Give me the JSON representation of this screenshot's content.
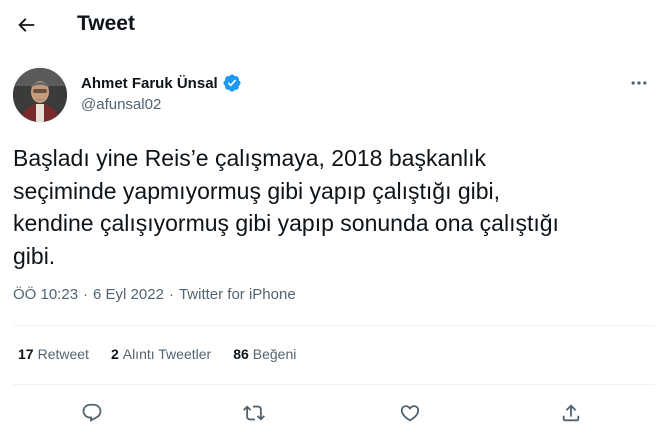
{
  "header": {
    "title": "Tweet",
    "back_icon": "arrow-left-icon"
  },
  "author": {
    "name": "Ahmet Faruk Ünsal",
    "handle": "@afunsal02",
    "verified": true,
    "verified_color": "#1d9bf0"
  },
  "tweet": {
    "text": "Başladı yine Reis’e çalışmaya, 2018 başkanlık\nseçiminde yapmıyormuş gibi yapıp çalıştığı gibi,\nkendine çalışıyormuş gibi yapıp sonunda ona çalıştığı\ngibi.",
    "time": "ÖÖ 10:23",
    "date": "6 Eyl 2022",
    "separator": "·",
    "source": "Twitter for iPhone"
  },
  "stats": {
    "retweets_count": "17",
    "retweets_label": "Retweet",
    "quotes_count": "2",
    "quotes_label": "Alıntı Tweetler",
    "likes_count": "86",
    "likes_label": "Beğeni"
  },
  "actions": [
    "reply-icon",
    "retweet-icon",
    "like-icon",
    "share-icon"
  ],
  "colors": {
    "text": "#0f1419",
    "secondary": "#536471",
    "divider": "#eff3f4",
    "accent": "#1d9bf0"
  }
}
